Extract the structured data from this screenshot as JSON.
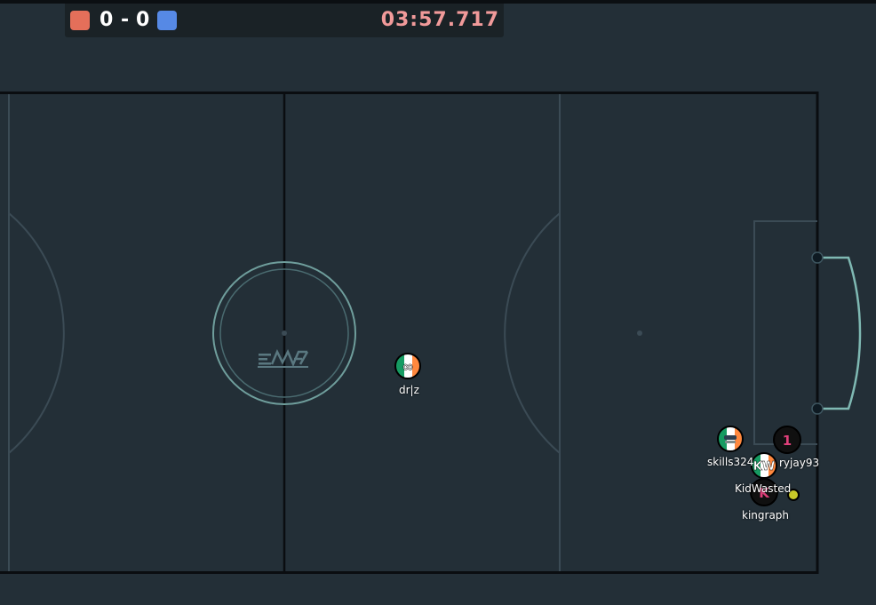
{
  "scoreboard": {
    "red_score": "0",
    "separator": "-",
    "blue_score": "0",
    "timer": "03:57.717",
    "red_color": "#e46f5a",
    "blue_color": "#5689e5"
  },
  "field": {
    "logo_text": "FUTSAL ASSOC"
  },
  "players": [
    {
      "name": "dr|z",
      "avatar": "∞",
      "flag": "ireland"
    },
    {
      "name": "skills324",
      "avatar": "mask-icon",
      "flag": "ireland"
    },
    {
      "name": "ryjay93",
      "avatar": "1",
      "avatar_color": "#e0407a"
    },
    {
      "name": "KidWasted",
      "avatar": "KW",
      "flag": "ireland"
    },
    {
      "name": "kingraph",
      "avatar": "K",
      "avatar_color": "#e0407a"
    }
  ]
}
